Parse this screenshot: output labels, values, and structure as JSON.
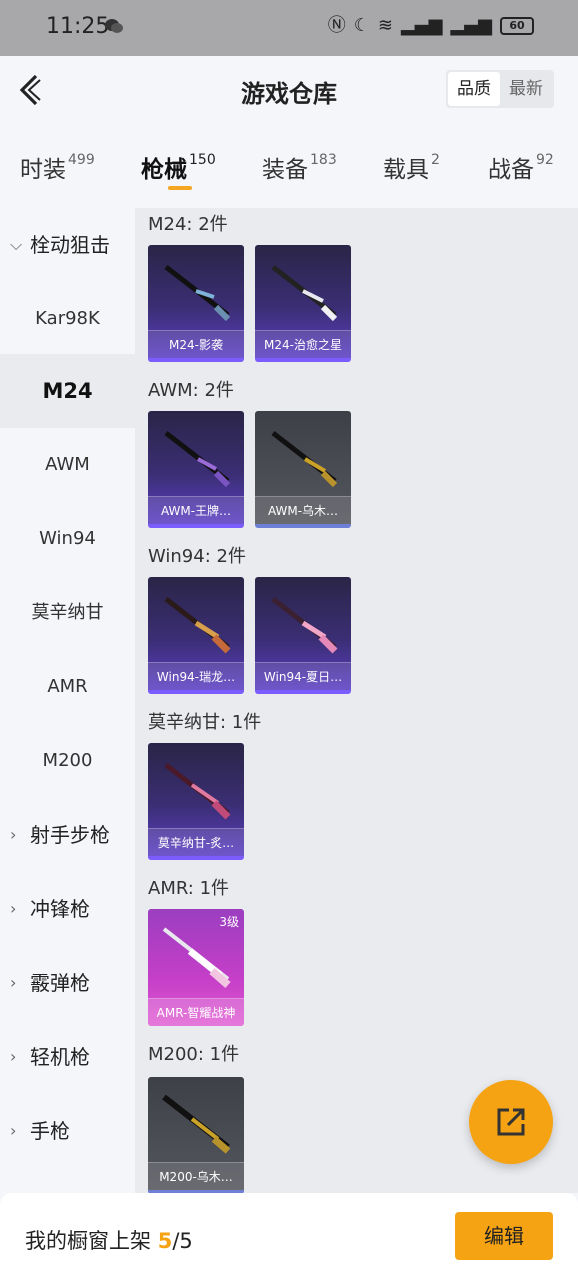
{
  "status_bar": {
    "time": "11:25",
    "battery": "60"
  },
  "header": {
    "title": "游戏仓库",
    "sort_options": [
      "品质",
      "最新"
    ]
  },
  "tabs": [
    {
      "label": "时装",
      "count": "499"
    },
    {
      "label": "枪械",
      "count": "150"
    },
    {
      "label": "装备",
      "count": "183"
    },
    {
      "label": "载具",
      "count": "2"
    },
    {
      "label": "战备",
      "count": "92"
    }
  ],
  "sidebar": {
    "group_open": "栓动狙击",
    "items": [
      "Kar98K",
      "M24",
      "AWM",
      "Win94",
      "莫辛纳甘",
      "AMR",
      "M200"
    ],
    "groups": [
      "射手步枪",
      "冲锋枪",
      "霰弹枪",
      "轻机枪",
      "手枪"
    ]
  },
  "sections": [
    {
      "label": "M24: 2件",
      "items": [
        {
          "name": "M24-影袭",
          "rarity": "purple"
        },
        {
          "name": "M24-治愈之星",
          "rarity": "purple"
        }
      ]
    },
    {
      "label": "AWM: 2件",
      "items": [
        {
          "name": "AWM-王牌…",
          "rarity": "purple"
        },
        {
          "name": "AWM-乌木…",
          "rarity": "gray"
        }
      ]
    },
    {
      "label": "Win94: 2件",
      "items": [
        {
          "name": "Win94-瑞龙…",
          "rarity": "purple"
        },
        {
          "name": "Win94-夏日…",
          "rarity": "purple"
        }
      ]
    },
    {
      "label": "莫辛纳甘: 1件",
      "items": [
        {
          "name": "莫辛纳甘-炙…",
          "rarity": "purple"
        }
      ]
    },
    {
      "label": "AMR: 1件",
      "items": [
        {
          "name": "AMR-智耀战神",
          "rarity": "pink",
          "level": "3级"
        }
      ]
    },
    {
      "label": "M200: 1件",
      "items": [
        {
          "name": "M200-乌木…",
          "rarity": "gray"
        }
      ]
    }
  ],
  "bottom": {
    "shelf_label": "我的橱窗上架",
    "shelf_used": "5",
    "shelf_total": "/5",
    "edit_label": "编辑"
  },
  "colors": {
    "accent": "#f5a313",
    "purple_card": "#3b2e74",
    "pink_card": "#c53fc8",
    "gray_card": "#55575e"
  }
}
